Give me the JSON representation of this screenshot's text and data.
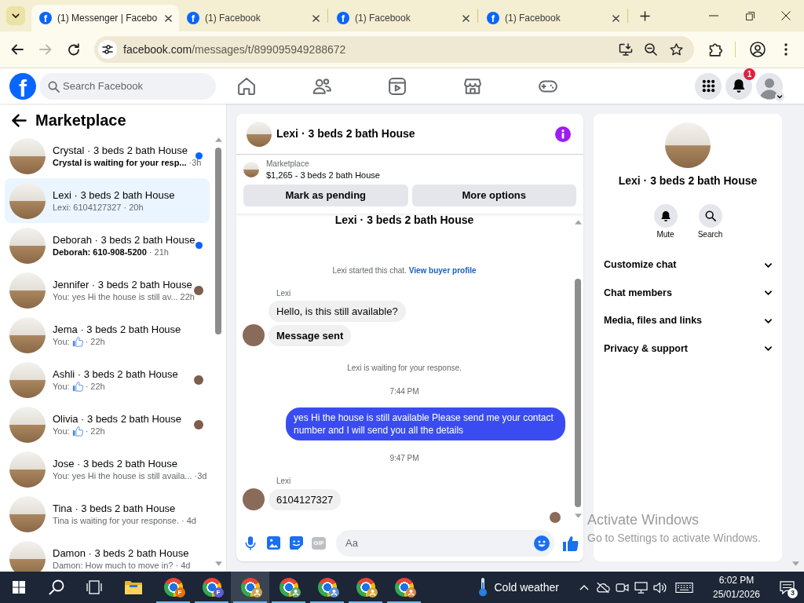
{
  "browser": {
    "tabs": [
      {
        "favicon": "f",
        "title": "(1) Messenger | Facebo",
        "selected": true
      },
      {
        "favicon": "f",
        "title": "(1) Facebook",
        "selected": false
      },
      {
        "favicon": "f",
        "title": "(1) Facebook",
        "selected": false
      },
      {
        "favicon": "f",
        "title": "(1) Facebook",
        "selected": false
      }
    ],
    "nav_buttons": [
      {
        "kind": "back",
        "disabled": false
      },
      {
        "kind": "forward",
        "disabled": true
      },
      {
        "kind": "reload",
        "disabled": false
      }
    ],
    "address": {
      "host": "facebook.com",
      "path": "/messages/t/899095949288672"
    }
  },
  "facebook_bar": {
    "logo": "f",
    "search": {
      "placeholder": "Search Facebook"
    },
    "nav": [
      {
        "kind": "home",
        "selected": false
      },
      {
        "kind": "friends",
        "selected": false
      },
      {
        "kind": "video",
        "selected": false
      },
      {
        "kind": "marketplace",
        "selected": false
      },
      {
        "kind": "gaming",
        "selected": false
      }
    ],
    "notification_badge": "1"
  },
  "sidebar": {
    "title": "Marketplace",
    "conversations": [
      {
        "title": "Crystal · 3 beds 2 bath House",
        "preview": "Crystal is waiting for your resp...",
        "like": false,
        "time": "·3h",
        "unread": true,
        "seen": false,
        "selected": false
      },
      {
        "title": "Lexi · 3 beds 2 bath House",
        "preview": "Lexi: 6104127327",
        "like": false,
        "time": "· 20h",
        "unread": false,
        "seen": false,
        "selected": true
      },
      {
        "title": "Deborah · 3 beds 2 bath House",
        "preview": "Deborah: 610-908-5200",
        "like": false,
        "time": "· 21h",
        "unread": true,
        "seen": false,
        "selected": false
      },
      {
        "title": "Jennifer · 3 beds 2 bath House",
        "preview": "You: yes Hi the house is still av...",
        "like": false,
        "time": "22h",
        "unread": false,
        "seen": true,
        "selected": false
      },
      {
        "title": "Jema · 3 beds 2 bath House",
        "preview": "You:",
        "like": true,
        "time": "· 22h",
        "unread": false,
        "seen": false,
        "selected": false
      },
      {
        "title": "Ashli · 3 beds 2 bath House",
        "preview": "You:",
        "like": true,
        "time": "· 22h",
        "unread": false,
        "seen": true,
        "selected": false
      },
      {
        "title": "Olivia · 3 beds 2 bath House",
        "preview": "You:",
        "like": true,
        "time": "· 22h",
        "unread": false,
        "seen": true,
        "selected": false
      },
      {
        "title": "Jose · 3 beds 2 bath House",
        "preview": "You: yes Hi the house is still availa...",
        "like": false,
        "time": "·3d",
        "unread": false,
        "seen": false,
        "selected": false
      },
      {
        "title": "Tina · 3 beds 2 bath House",
        "preview": "Tina is waiting for your response.",
        "like": false,
        "time": "· 4d",
        "unread": false,
        "seen": false,
        "selected": false
      },
      {
        "title": "Damon · 3 beds 2 bath House",
        "preview": "Damon: How much to move in?",
        "like": false,
        "time": "· 4d",
        "unread": false,
        "seen": false,
        "selected": false
      }
    ]
  },
  "chat": {
    "title": "Lexi · 3 beds 2 bath House",
    "listing": {
      "label": "Marketplace",
      "summary": "$1,265 - 3 beds 2 bath House"
    },
    "actions": [
      "Mark as pending",
      "More options"
    ],
    "thread_title": "Lexi · 3 beds 2 bath House",
    "messages": [
      {
        "kind": "system",
        "text": "Lexi started this chat.",
        "link": "View buyer profile"
      },
      {
        "kind": "sender",
        "text": "Lexi"
      },
      {
        "kind": "incoming",
        "text": "Hello, is this still available?",
        "avatar": false,
        "bold": false
      },
      {
        "kind": "incoming",
        "text": "Message sent",
        "avatar": true,
        "bold": true
      },
      {
        "kind": "system",
        "text": "Lexi is waiting for your response."
      },
      {
        "kind": "time",
        "text": "7:44 PM"
      },
      {
        "kind": "outgoing",
        "text": "yes Hi the house is still available Please send me your contact number and I will send you all the details"
      },
      {
        "kind": "time",
        "text": "9:47 PM"
      },
      {
        "kind": "sender",
        "text": "Lexi"
      },
      {
        "kind": "incoming",
        "text": "6104127327",
        "avatar": true,
        "bold": false
      }
    ],
    "read_receipt": true,
    "composer": {
      "gif_label": "GIF",
      "placeholder": "Aa"
    }
  },
  "details": {
    "title": "Lexi · 3 beds 2 bath House",
    "actions": [
      {
        "kind": "mute",
        "label": "Mute"
      },
      {
        "kind": "search",
        "label": "Search"
      }
    ],
    "sections": [
      {
        "label": "Customize chat",
        "expanded": false
      },
      {
        "label": "Chat members",
        "expanded": false
      },
      {
        "label": "Media, files and links",
        "expanded": false
      },
      {
        "label": "Privacy & support",
        "expanded": false
      }
    ]
  },
  "os_notice": {
    "title": "Activate Windows",
    "text": "Go to Settings to activate Windows."
  },
  "taskbar": {
    "apps": [
      {
        "kind": "start",
        "open": false,
        "selected": false
      },
      {
        "kind": "search",
        "open": false,
        "selected": false
      },
      {
        "kind": "task_view",
        "open": false,
        "selected": false
      },
      {
        "kind": "explorer",
        "open": false,
        "selected": false
      },
      {
        "kind": "chrome",
        "badge": "F",
        "color": "#e8710a",
        "open": true,
        "selected": false
      },
      {
        "kind": "chrome",
        "badge": "F",
        "color": "#5c5fd6",
        "open": true,
        "selected": false
      },
      {
        "kind": "chrome",
        "color": "#c9a65a",
        "open": true,
        "selected": true
      },
      {
        "kind": "chrome",
        "color": "#6aa86a",
        "open": true,
        "selected": false
      },
      {
        "kind": "chrome",
        "color": "#5b93d3",
        "open": true,
        "selected": false
      },
      {
        "kind": "chrome",
        "color": "#d6a93c",
        "open": true,
        "selected": false
      },
      {
        "kind": "chrome",
        "color": "#d98a45",
        "open": true,
        "selected": false
      }
    ],
    "weather": "Cold weather",
    "time": "6:02 PM",
    "date": "25/01/2026",
    "notification_count": "3"
  }
}
